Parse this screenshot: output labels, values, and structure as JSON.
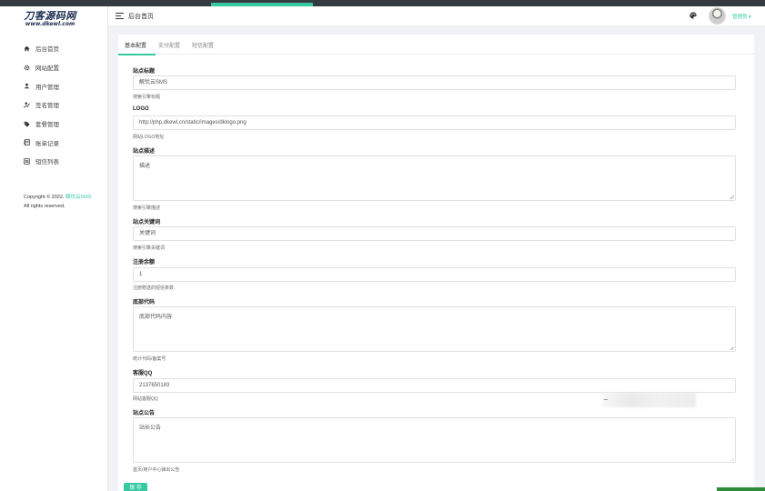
{
  "colors": {
    "accent": "#36c9a2",
    "topbar": "#343a40"
  },
  "logo": {
    "line1": "刀客源码网",
    "line2": "www.dkewl.com"
  },
  "sidebar": {
    "items": [
      {
        "label": "后台首页",
        "icon": "home-icon"
      },
      {
        "label": "网站配置",
        "icon": "gear-icon"
      },
      {
        "label": "用户管理",
        "icon": "user-icon"
      },
      {
        "label": "签名管理",
        "icon": "signature-icon"
      },
      {
        "label": "套餐管理",
        "icon": "tag-icon"
      },
      {
        "label": "账单记录",
        "icon": "bill-icon"
      },
      {
        "label": "短信列表",
        "icon": "list-icon"
      }
    ],
    "copyright": {
      "prefix": "Copyright © 2022.",
      "link": "解忧云SMS",
      "suffix": "All rights reserved."
    }
  },
  "header": {
    "title": "后台首页",
    "admin_label": "管理员 ▾"
  },
  "tabs": [
    {
      "label": "基本配置",
      "active": true
    },
    {
      "label": "支付配置",
      "active": false
    },
    {
      "label": "短信配置",
      "active": false
    }
  ],
  "form": {
    "site_title": {
      "label": "站点标题",
      "value": "解忧云SMS",
      "help": "搜索引擎标题"
    },
    "logo": {
      "label": "LOGO",
      "value": "http://php.dkewl.cn/static/images/dklogo.png",
      "help": "网站LOGO地址"
    },
    "description": {
      "label": "站点描述",
      "value": "描述",
      "help": "搜索引擎描述"
    },
    "keywords": {
      "label": "站点关键词",
      "value": "关键词",
      "help": "搜索引擎关键词"
    },
    "register_balance": {
      "label": "注册余额",
      "value": "1",
      "help": "注册赠送的短信条数"
    },
    "footer_code": {
      "label": "底部代码",
      "value": "底部代码内容",
      "help": "统计代码/备案号"
    },
    "service_qq": {
      "label": "客服QQ",
      "value": "2137650183",
      "help": "网站客服QQ"
    },
    "notice": {
      "label": "站点公告",
      "value": "站长公告",
      "help": "首页/用户中心弹出公告"
    }
  },
  "save_label": "保 存"
}
